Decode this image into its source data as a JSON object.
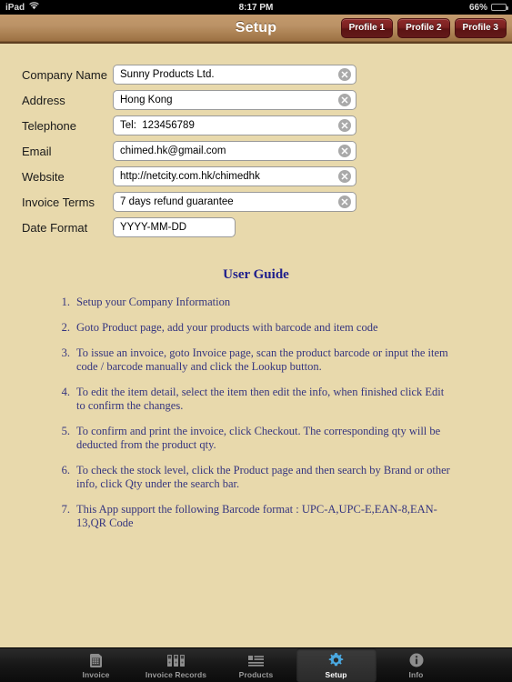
{
  "status_bar": {
    "device": "iPad",
    "wifi_icon": "wifi-icon",
    "time": "8:17 PM",
    "battery_percent": "66%",
    "battery_icon": "battery-icon"
  },
  "nav": {
    "title": "Setup",
    "buttons": [
      {
        "label": "Profile 1",
        "name": "profile-1-button"
      },
      {
        "label": "Profile 2",
        "name": "profile-2-button"
      },
      {
        "label": "Profile 3",
        "name": "profile-3-button"
      }
    ]
  },
  "form": {
    "fields": [
      {
        "label": "Company Name",
        "value": "Sunny Products Ltd.",
        "placeholder": "",
        "clearable": true
      },
      {
        "label": "Address",
        "value": "Hong Kong",
        "placeholder": "",
        "clearable": true
      },
      {
        "label": "Telephone",
        "value": "Tel:  123456789",
        "placeholder": "",
        "clearable": true
      },
      {
        "label": "Email",
        "value": "chimed.hk@gmail.com",
        "placeholder": "",
        "clearable": true
      },
      {
        "label": "Website",
        "value": "http://netcity.com.hk/chimedhk",
        "placeholder": "",
        "clearable": true
      },
      {
        "label": "Invoice Terms",
        "value": "7 days refund guarantee",
        "placeholder": "",
        "clearable": true
      },
      {
        "label": "Date Format",
        "value": "YYYY-MM-DD",
        "placeholder": "",
        "clearable": false
      }
    ]
  },
  "guide": {
    "title": "User Guide",
    "items": [
      {
        "num": "1.",
        "text": "Setup your Company Information"
      },
      {
        "num": "2.",
        "text": "Goto Product page, add your products with barcode and item code"
      },
      {
        "num": "3.",
        "text": "To issue an invoice, goto Invoice page, scan the product barcode or input the item code / barcode manually and click the Lookup button."
      },
      {
        "num": "4.",
        "text": "To edit the item detail, select the item then edit the info, when finished click Edit to confirm the changes."
      },
      {
        "num": "5.",
        "text": "To confirm and print the invoice, click Checkout. The corresponding qty will be deducted from the product qty."
      },
      {
        "num": "6.",
        "text": "To check the stock level, click the Product page and then search by Brand or other info, click Qty under the search bar."
      },
      {
        "num": "7.",
        "text": "This App support the following Barcode format : UPC-A,UPC-E,EAN-8,EAN-13,QR Code"
      }
    ]
  },
  "tab_bar": {
    "items": [
      {
        "label": "Invoice",
        "icon": "calculator-icon",
        "selected": false
      },
      {
        "label": "Invoice Records",
        "icon": "binders-icon",
        "selected": false
      },
      {
        "label": "Products",
        "icon": "list-icon",
        "selected": false
      },
      {
        "label": "Setup",
        "icon": "gear-icon",
        "selected": true
      },
      {
        "label": "Info",
        "icon": "info-icon",
        "selected": false
      }
    ]
  },
  "colors": {
    "page_background": "#e8d9ac",
    "navbar_brown": "#bb9266",
    "profile_button_red": "#7a2020",
    "guide_text_blue": "#35357f",
    "tab_selected_blue": "#4aa8e0"
  }
}
